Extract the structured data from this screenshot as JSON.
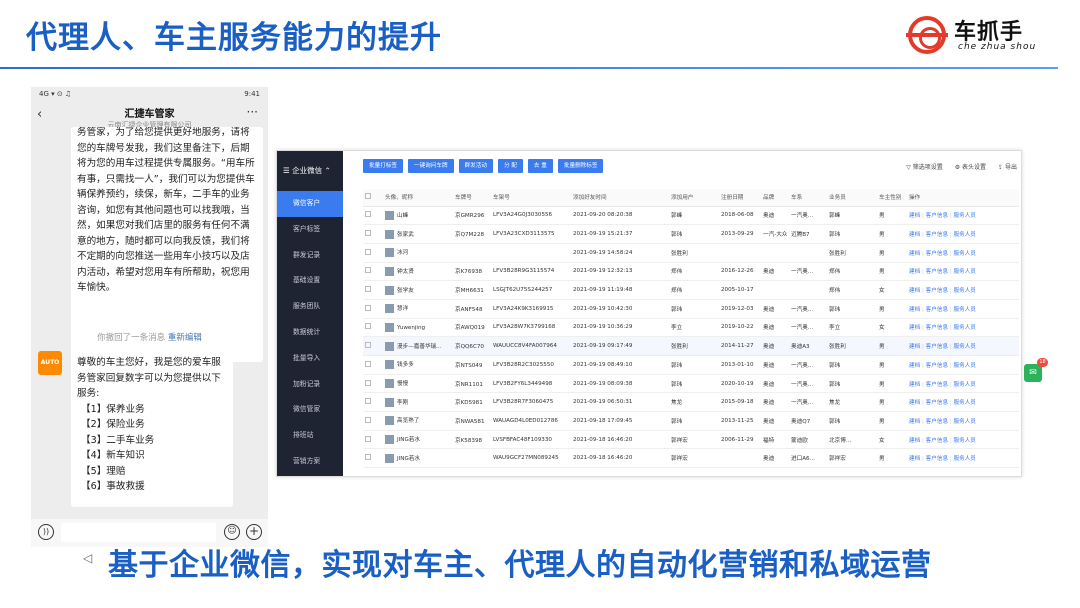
{
  "header": {
    "title": "代理人、车主服务能力的提升",
    "logo_cn": "车抓手",
    "logo_en": "che zhua shou"
  },
  "phone": {
    "status_left": "4G ▾ ⊙ ♫",
    "status_time": "9:41",
    "contact_name": "汇捷车管家",
    "contact_sub": "云南汇捷企业管理有限公司",
    "message1": "务管家，为了给您提供更好地服务，请将您的车牌号发我，我们这里备注下，后期将为您的用车过程提供专属服务。“用车所有事，只需找一人”，我们可以为您提供车辆保养预约，续保，新车，二手车的业务咨询，如您有其他问题也可以找我哦，当然，如果您对我们店里的服务有任何不满意的地方，随时都可以向我反馈，我们将不定期的向您推送一些用车小技巧以及店内活动，希望对您用车有所帮助，祝您用车愉快。",
    "recall_text": "你撤回了一条消息",
    "recall_action": "重新编辑",
    "avatar_text": "AUTO",
    "message2_intro": "尊敬的车主您好，我是您的爱车服务管家回复数字可以为您提供以下服务:",
    "services": [
      "【1】保养业务",
      "【2】保险业务",
      "【3】二手车业务",
      "【4】新车知识",
      "【5】理赔",
      "【6】事故救援"
    ],
    "back_icon": "chevron-left-icon",
    "more_icon": "more-dots-icon"
  },
  "admin": {
    "brand": "企业微信",
    "menu": [
      "微信客户",
      "客户标签",
      "群发记录",
      "基础设置",
      "服务团队",
      "数据统计",
      "批量导入",
      "加粉记录",
      "微信管家",
      "排班站",
      "营销方案"
    ],
    "active_menu": "微信客户",
    "buttons": [
      "批量打标签",
      "一键询问车牌",
      "群发活动",
      "分 配",
      "去 重",
      "批量删除标签"
    ],
    "tools": [
      "筛选项设置",
      "表头设置",
      "导出"
    ],
    "columns": [
      "",
      "头像、昵称",
      "车牌号",
      "车架号",
      "添加好友时间",
      "添加用户",
      "注册日期",
      "品牌",
      "车系",
      "业务员",
      "车主性别",
      "操作"
    ],
    "ops": [
      "建档",
      "客户信息",
      "服务人员"
    ],
    "rows": [
      [
        "山峰",
        "京GMR296",
        "LFV3A24G0J3030556",
        "2021-09-20 08:20:38",
        "郭峰",
        "2018-06-08",
        "奥迪",
        "一汽奥...",
        "郭峰",
        "男"
      ],
      [
        "张家武",
        "京Q7M228",
        "LFV3A23CXD3113575",
        "2021-09-19 15:21:37",
        "郭玮",
        "2013-09-29",
        "一汽-大众",
        "迈腾B7",
        "郭玮",
        "男"
      ],
      [
        "冰河",
        "",
        "",
        "2021-09-19 14:58:24",
        "张胜利",
        "",
        "",
        "",
        "张胜利",
        "男"
      ],
      [
        "钟太贤",
        "京K76938",
        "LFV3B28R9G3115574",
        "2021-09-19 12:32:13",
        "郑伟",
        "2016-12-26",
        "奥迪",
        "一汽奥...",
        "郑伟",
        "男"
      ],
      [
        "张学友",
        "京MH6631",
        "LSGJT62U75S244257",
        "2021-09-19 11:19:48",
        "郑伟",
        "2005-10-17",
        "",
        "",
        "郑伟",
        "女"
      ],
      [
        "慧洋",
        "京ANF548",
        "LFV3A24K9K3169915",
        "2021-09-19 10:42:30",
        "郭玮",
        "2019-12-03",
        "奥迪",
        "一汽奥...",
        "郭玮",
        "男"
      ],
      [
        "Yuwenjing",
        "京AWQ019",
        "LFV3A28W7K3799168",
        "2021-09-19 10:36:29",
        "李立",
        "2019-10-22",
        "奥迪",
        "一汽奥...",
        "李立",
        "女"
      ],
      [
        "漫步—嘉善华瑞...",
        "京QQ6C70",
        "WAUUCC8V4FA007964",
        "2021-09-19 09:17:49",
        "张胜利",
        "2014-11-27",
        "奥迪",
        "奥迪A3",
        "张胜利",
        "男"
      ],
      [
        "钱多多",
        "京NTS049",
        "LFV3B28R2C3025550",
        "2021-09-19 08:49:10",
        "郭玮",
        "2013-01-10",
        "奥迪",
        "一汽奥...",
        "郭玮",
        "男"
      ],
      [
        "慢慢",
        "京NR1101",
        "LFV3B2FY6L3449498",
        "2021-09-19 08:09:38",
        "郭玮",
        "2020-10-19",
        "奥迪",
        "一汽奥...",
        "郭玮",
        "男"
      ],
      [
        "李刚",
        "京KD5981",
        "LFV3B28R7F3060475",
        "2021-09-19 06:50:31",
        "焦龙",
        "2015-09-18",
        "奥迪",
        "一汽奥...",
        "焦龙",
        "男"
      ],
      [
        "高览熟了",
        "京NWA581",
        "WAUAGD4L0ED012786",
        "2021-09-18 17:09:45",
        "郭玮",
        "2013-11-25",
        "奥迪",
        "奥迪Q7",
        "郭玮",
        "男"
      ],
      [
        "JING若水",
        "京K58398",
        "LVSFBFAC48F109330",
        "2021-09-18 16:46:20",
        "郭祥宏",
        "2006-11-29",
        "福特",
        "蒙迪欧",
        "北京博...",
        "女"
      ],
      [
        "JING若水",
        "",
        "WAU9GCF27MN089245",
        "2021-09-18 16:46:20",
        "郭祥宏",
        "",
        "奥迪",
        "进口A6...",
        "郭祥宏",
        "男"
      ]
    ]
  },
  "footer": {
    "subtitle": "基于企业微信，实现对车主、代理人的自动化营销和私域运营",
    "nav_back": "◁"
  },
  "colors": {
    "title_blue": "#1a5fc4",
    "accent_blue": "#3a7bf0",
    "logo_red": "#e23b2b",
    "sidebar_dark": "#1f2433"
  }
}
